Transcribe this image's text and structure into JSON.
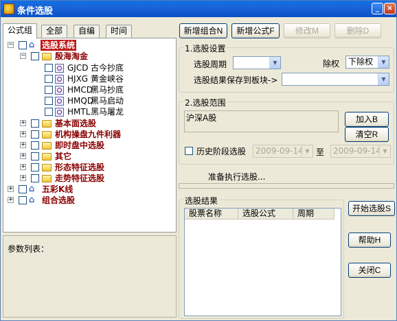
{
  "window": {
    "title": "条件选股"
  },
  "tabs": [
    "公式组",
    "全部",
    "自编",
    "时间"
  ],
  "tree": {
    "root": {
      "label": "选股系统"
    },
    "group1": {
      "label": "殷海淘金",
      "items": [
        {
          "code": "GJCD",
          "name": "古今抄底"
        },
        {
          "code": "HJXG",
          "name": "黄金峡谷"
        },
        {
          "code": "HMCD",
          "name": "黑马抄底"
        },
        {
          "code": "HMQD",
          "name": "黑马启动"
        },
        {
          "code": "HMTL",
          "name": "黑马屠龙"
        }
      ]
    },
    "folders": [
      "基本面选股",
      "机构操盘九件利器",
      "即时盘中选股",
      "其它",
      "形态特征选股",
      "走势特征选股"
    ],
    "roots": [
      "五彩K线",
      "组合选股"
    ]
  },
  "params": {
    "label": "参数列表："
  },
  "toolbar": {
    "new_group": "新增组合N",
    "new_formula": "新增公式F",
    "modify": "修改M",
    "delete": "删除D"
  },
  "settings": {
    "title": "1.选股设置",
    "period_label": "选股周期",
    "period_value": "",
    "exright_label": "除权",
    "exright_value": "下除权",
    "save_label": "选股结果保存到板块->",
    "save_value": ""
  },
  "range": {
    "title": "2.选股范围",
    "selected": "沪深A股",
    "add_button": "加入B",
    "clear_button": "清空R",
    "history_label": "历史阶段选股",
    "date_from": "2009-09-14",
    "to_label": "至",
    "date_to": "2009-09-14"
  },
  "status": {
    "text": "准备执行选股..."
  },
  "results": {
    "title": "选股结果",
    "columns": [
      "股票名称",
      "选股公式",
      "周期"
    ]
  },
  "actions": {
    "start": "开始选股S",
    "help": "帮助H",
    "close": "关闭C"
  }
}
